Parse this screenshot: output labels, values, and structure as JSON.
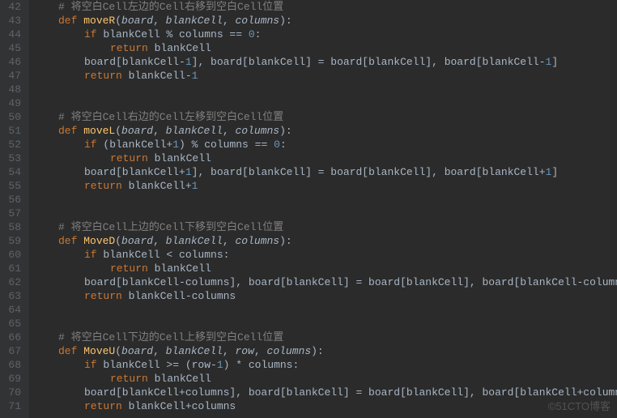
{
  "startLine": 42,
  "watermark": "©51CTO博客",
  "lines": [
    {
      "indent": 1,
      "tokens": [
        {
          "t": "cmt",
          "v": "# 将空白Cell左边的Cell右移到空白Cell位置"
        }
      ]
    },
    {
      "indent": 1,
      "tokens": [
        {
          "t": "kw",
          "v": "def "
        },
        {
          "t": "fn",
          "v": "moveR"
        },
        {
          "t": "op",
          "v": "("
        },
        {
          "t": "prm",
          "v": "board"
        },
        {
          "t": "op",
          "v": ", "
        },
        {
          "t": "prm",
          "v": "blankCell"
        },
        {
          "t": "op",
          "v": ", "
        },
        {
          "t": "prm",
          "v": "columns"
        },
        {
          "t": "op",
          "v": "):"
        }
      ]
    },
    {
      "indent": 2,
      "tokens": [
        {
          "t": "kw",
          "v": "if "
        },
        {
          "t": "op",
          "v": "blankCell % columns == "
        },
        {
          "t": "num",
          "v": "0"
        },
        {
          "t": "op",
          "v": ":"
        }
      ]
    },
    {
      "indent": 3,
      "tokens": [
        {
          "t": "kw",
          "v": "return "
        },
        {
          "t": "op",
          "v": "blankCell"
        }
      ]
    },
    {
      "indent": 2,
      "tokens": [
        {
          "t": "op",
          "v": "board[blankCell-"
        },
        {
          "t": "num",
          "v": "1"
        },
        {
          "t": "op",
          "v": "], board[blankCell] = board[blankCell], board[blankCell-"
        },
        {
          "t": "num",
          "v": "1"
        },
        {
          "t": "op",
          "v": "]"
        }
      ]
    },
    {
      "indent": 2,
      "tokens": [
        {
          "t": "kw",
          "v": "return "
        },
        {
          "t": "op",
          "v": "blankCell-"
        },
        {
          "t": "num",
          "v": "1"
        }
      ]
    },
    {
      "indent": 0,
      "tokens": []
    },
    {
      "indent": 0,
      "tokens": []
    },
    {
      "indent": 1,
      "tokens": [
        {
          "t": "cmt",
          "v": "# 将空白Cell右边的Cell左移到空白Cell位置"
        }
      ]
    },
    {
      "indent": 1,
      "tokens": [
        {
          "t": "kw",
          "v": "def "
        },
        {
          "t": "fn",
          "v": "moveL"
        },
        {
          "t": "op",
          "v": "("
        },
        {
          "t": "prm",
          "v": "board"
        },
        {
          "t": "op",
          "v": ", "
        },
        {
          "t": "prm",
          "v": "blankCell"
        },
        {
          "t": "op",
          "v": ", "
        },
        {
          "t": "prm",
          "v": "columns"
        },
        {
          "t": "op",
          "v": "):"
        }
      ]
    },
    {
      "indent": 2,
      "tokens": [
        {
          "t": "kw",
          "v": "if "
        },
        {
          "t": "op",
          "v": "(blankCell+"
        },
        {
          "t": "num",
          "v": "1"
        },
        {
          "t": "op",
          "v": ") % columns == "
        },
        {
          "t": "num",
          "v": "0"
        },
        {
          "t": "op",
          "v": ":"
        }
      ]
    },
    {
      "indent": 3,
      "tokens": [
        {
          "t": "kw",
          "v": "return "
        },
        {
          "t": "op",
          "v": "blankCell"
        }
      ]
    },
    {
      "indent": 2,
      "tokens": [
        {
          "t": "op",
          "v": "board[blankCell+"
        },
        {
          "t": "num",
          "v": "1"
        },
        {
          "t": "op",
          "v": "], board[blankCell] = board[blankCell], board[blankCell+"
        },
        {
          "t": "num",
          "v": "1"
        },
        {
          "t": "op",
          "v": "]"
        }
      ]
    },
    {
      "indent": 2,
      "tokens": [
        {
          "t": "kw",
          "v": "return "
        },
        {
          "t": "op",
          "v": "blankCell+"
        },
        {
          "t": "num",
          "v": "1"
        }
      ]
    },
    {
      "indent": 0,
      "tokens": []
    },
    {
      "indent": 0,
      "tokens": []
    },
    {
      "indent": 1,
      "tokens": [
        {
          "t": "cmt",
          "v": "# 将空白Cell上边的Cell下移到空白Cell位置"
        }
      ]
    },
    {
      "indent": 1,
      "tokens": [
        {
          "t": "kw",
          "v": "def "
        },
        {
          "t": "fn",
          "v": "MoveD"
        },
        {
          "t": "op",
          "v": "("
        },
        {
          "t": "prm",
          "v": "board"
        },
        {
          "t": "op",
          "v": ", "
        },
        {
          "t": "prm",
          "v": "blankCell"
        },
        {
          "t": "op",
          "v": ", "
        },
        {
          "t": "prm",
          "v": "columns"
        },
        {
          "t": "op",
          "v": "):"
        }
      ]
    },
    {
      "indent": 2,
      "tokens": [
        {
          "t": "kw",
          "v": "if "
        },
        {
          "t": "op",
          "v": "blankCell < columns:"
        }
      ]
    },
    {
      "indent": 3,
      "tokens": [
        {
          "t": "kw",
          "v": "return "
        },
        {
          "t": "op",
          "v": "blankCell"
        }
      ]
    },
    {
      "indent": 2,
      "tokens": [
        {
          "t": "op",
          "v": "board[blankCell-columns], board[blankCell] = board[blankCell], board[blankCell-columns]"
        }
      ]
    },
    {
      "indent": 2,
      "tokens": [
        {
          "t": "kw",
          "v": "return "
        },
        {
          "t": "op",
          "v": "blankCell-columns"
        }
      ]
    },
    {
      "indent": 0,
      "tokens": []
    },
    {
      "indent": 0,
      "tokens": []
    },
    {
      "indent": 1,
      "tokens": [
        {
          "t": "cmt",
          "v": "# 将空白Cell下边的Cell上移到空白Cell位置"
        }
      ]
    },
    {
      "indent": 1,
      "tokens": [
        {
          "t": "kw",
          "v": "def "
        },
        {
          "t": "fn",
          "v": "MoveU"
        },
        {
          "t": "op",
          "v": "("
        },
        {
          "t": "prm",
          "v": "board"
        },
        {
          "t": "op",
          "v": ", "
        },
        {
          "t": "prm",
          "v": "blankCell"
        },
        {
          "t": "op",
          "v": ", "
        },
        {
          "t": "prm",
          "v": "row"
        },
        {
          "t": "op",
          "v": ", "
        },
        {
          "t": "prm",
          "v": "columns"
        },
        {
          "t": "op",
          "v": "):"
        }
      ]
    },
    {
      "indent": 2,
      "tokens": [
        {
          "t": "kw",
          "v": "if "
        },
        {
          "t": "op",
          "v": "blankCell >= (row-"
        },
        {
          "t": "num",
          "v": "1"
        },
        {
          "t": "op",
          "v": ") * columns:"
        }
      ]
    },
    {
      "indent": 3,
      "tokens": [
        {
          "t": "kw",
          "v": "return "
        },
        {
          "t": "op",
          "v": "blankCell"
        }
      ]
    },
    {
      "indent": 2,
      "tokens": [
        {
          "t": "op",
          "v": "board[blankCell+columns], board[blankCell] = board[blankCell], board[blankCell+columns]"
        }
      ]
    },
    {
      "indent": 2,
      "tokens": [
        {
          "t": "kw",
          "v": "return "
        },
        {
          "t": "op",
          "v": "blankCell+columns"
        }
      ]
    }
  ]
}
